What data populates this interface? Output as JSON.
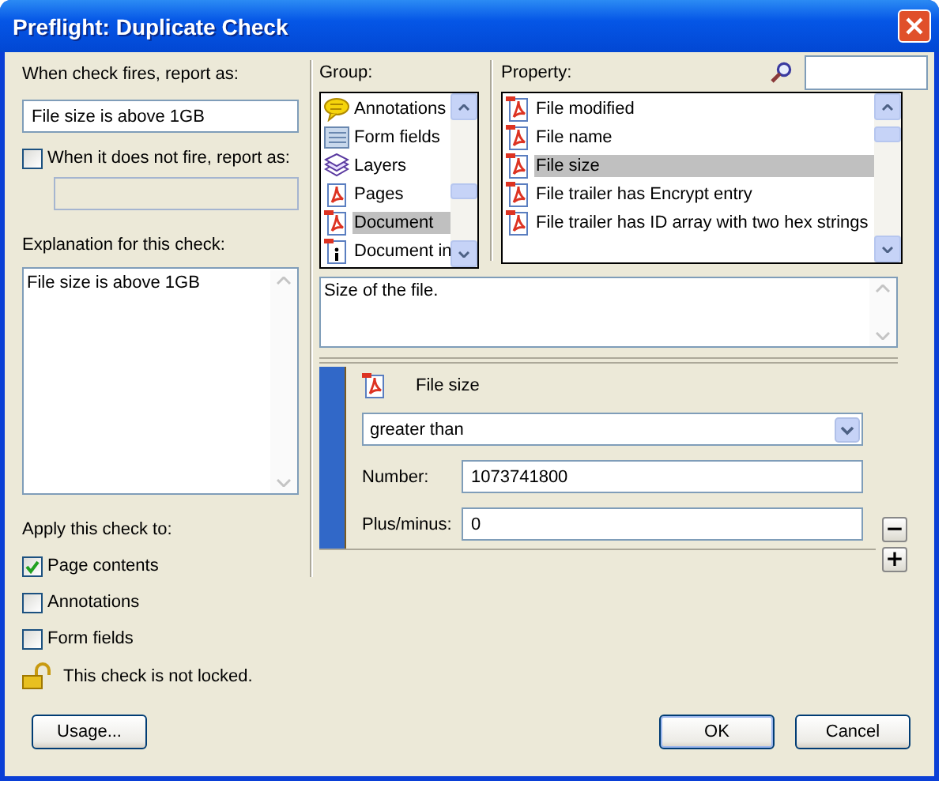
{
  "window": {
    "title": "Preflight: Duplicate Check"
  },
  "report": {
    "label": "When check fires, report as:",
    "value": "File size is above 1GB"
  },
  "not_fire": {
    "label": "When it does not fire, report as:",
    "checked": false,
    "disabled": true
  },
  "explanation": {
    "label": "Explanation for this check:",
    "value": "File size is above 1GB"
  },
  "apply": {
    "label": "Apply this check to:",
    "options": [
      {
        "label": "Page contents",
        "checked": true
      },
      {
        "label": "Annotations",
        "checked": false
      },
      {
        "label": "Form fields",
        "checked": false
      }
    ]
  },
  "lock": {
    "text": "This check is not locked.",
    "locked": false
  },
  "group": {
    "label": "Group:",
    "items": [
      {
        "label": "Annotations",
        "kind": "bubble",
        "selected": false
      },
      {
        "label": "Form fields",
        "kind": "form",
        "selected": false
      },
      {
        "label": "Layers",
        "kind": "layers",
        "selected": false
      },
      {
        "label": "Pages",
        "kind": "pdf",
        "selected": false
      },
      {
        "label": "Document",
        "kind": "flagged",
        "selected": true
      },
      {
        "label": "Document in",
        "kind": "info",
        "selected": false
      }
    ]
  },
  "property": {
    "label": "Property:",
    "items": [
      {
        "label": "File modified",
        "selected": false
      },
      {
        "label": "File name",
        "selected": false
      },
      {
        "label": "File size",
        "selected": true
      },
      {
        "label": "File trailer has Encrypt entry",
        "selected": false
      },
      {
        "label": "File trailer has ID array with two hex strings",
        "selected": false
      }
    ]
  },
  "description": "Size of the file.",
  "condition": {
    "property": "File size",
    "operator": "greater than",
    "fields": [
      {
        "label": "Number:",
        "value": "1073741800"
      },
      {
        "label": "Plus/minus:",
        "value": "0"
      }
    ],
    "remove": "−",
    "add": "+"
  },
  "buttons": {
    "usage": "Usage...",
    "ok": "OK",
    "cancel": "Cancel"
  }
}
